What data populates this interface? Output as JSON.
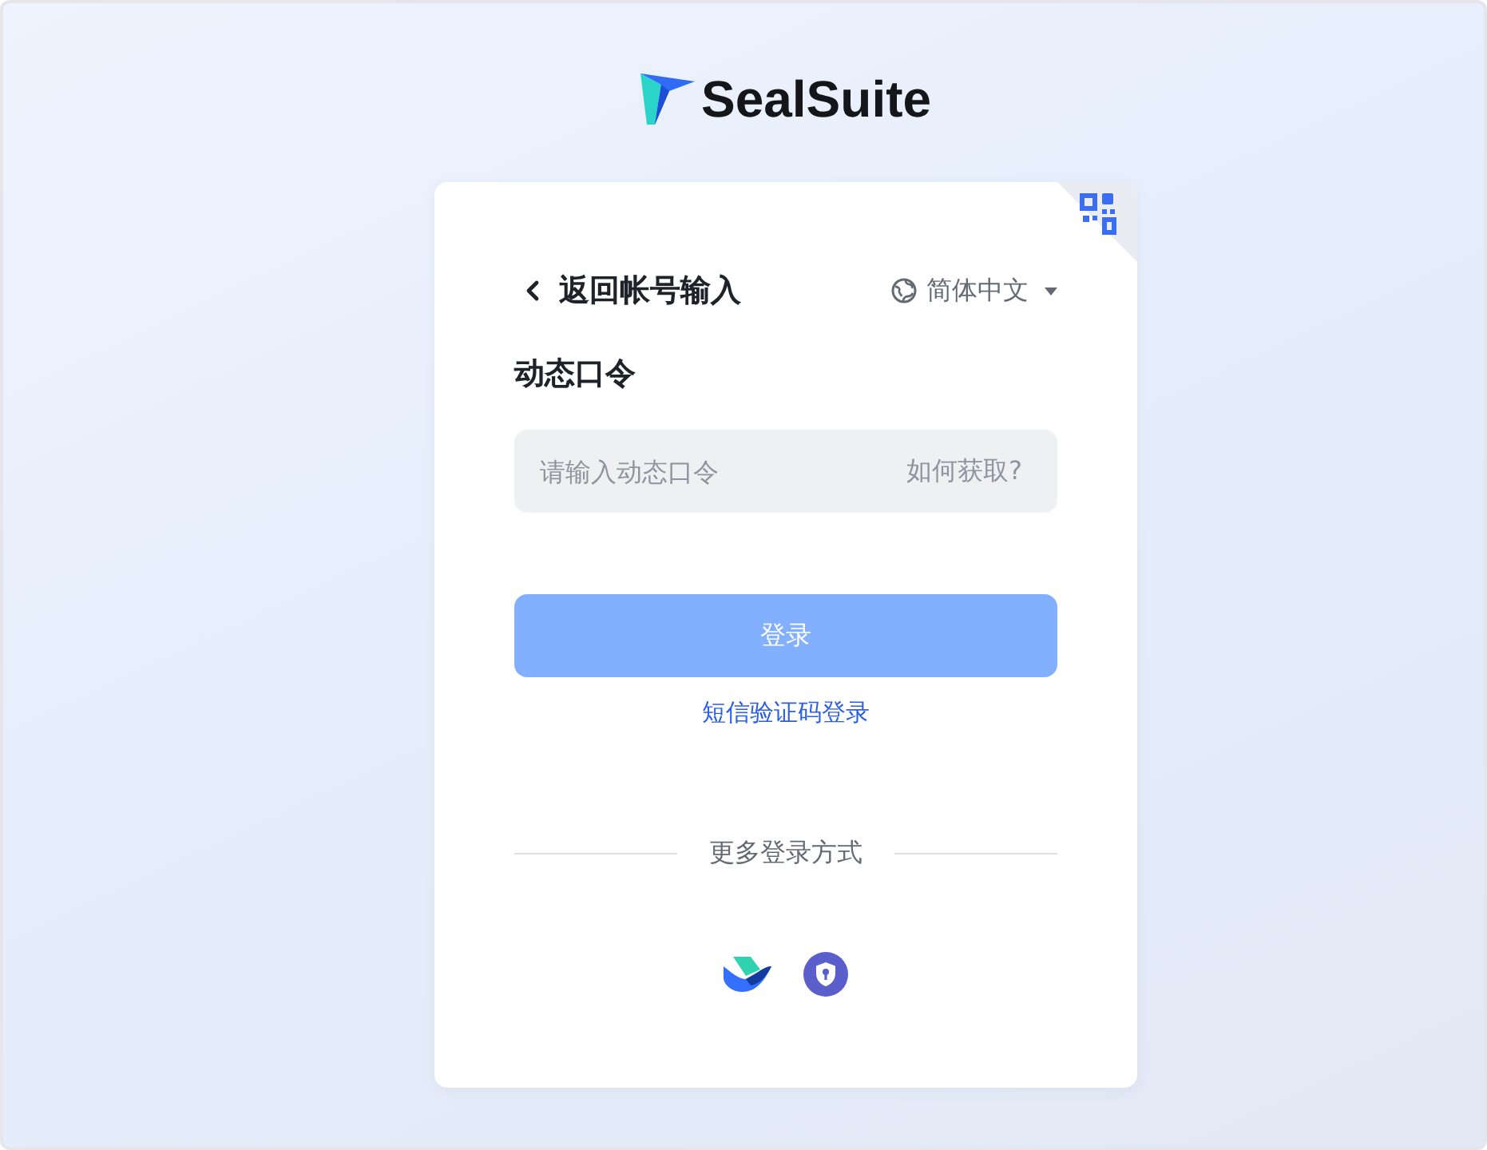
{
  "brand": {
    "name": "SealSuite"
  },
  "card": {
    "back_link": {
      "label": "返回帐号输入"
    },
    "language": {
      "label": "简体中文"
    },
    "title": "动态口令",
    "field": {
      "placeholder": "请输入动态口令",
      "help": "如何获取?"
    },
    "login_button": {
      "label": "登录",
      "disabled": true
    },
    "alt_link": {
      "label": "短信验证码登录"
    },
    "divider": {
      "label": "更多登录方式"
    },
    "other_methods": [
      {
        "kind": "app"
      },
      {
        "kind": "security"
      }
    ]
  }
}
